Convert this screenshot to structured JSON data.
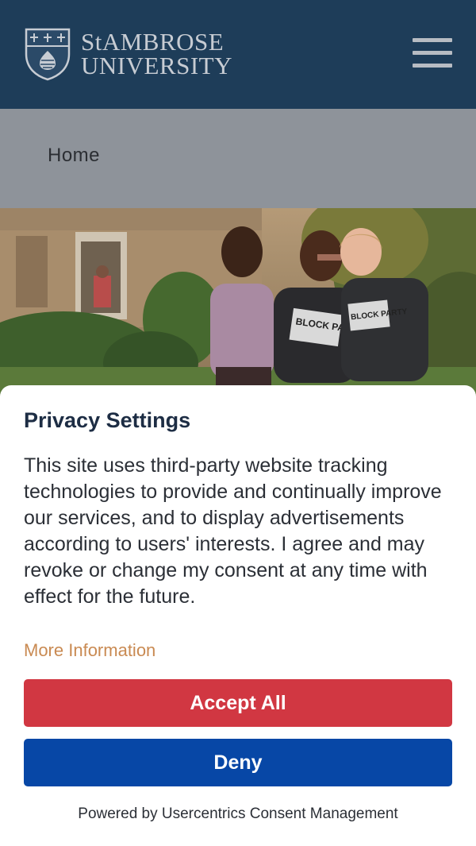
{
  "header": {
    "brand_line1": "StAMBROSE",
    "brand_line2": "UNIVERSITY",
    "brand_color": "#1e3d59",
    "menu_icon": "hamburger-menu-icon"
  },
  "breadcrumb": {
    "home_label": "Home"
  },
  "hero": {
    "shirt_text_1": "BLOCK PARTY",
    "shirt_text_2": "BLOCK PARTY"
  },
  "consent": {
    "title": "Privacy Settings",
    "body": "This site uses third-party website tracking technologies to provide and continually improve our services, and to display advertisements according to users' interests. I agree and may revoke or change my consent at any time with effect for the future.",
    "more_info_label": "More Information",
    "accept_label": "Accept All",
    "deny_label": "Deny",
    "powered_by": "Powered by Usercentrics Consent Management",
    "colors": {
      "accept": "#d13742",
      "deny": "#0747a6",
      "link": "#c98a52",
      "title": "#1d2d44"
    }
  }
}
